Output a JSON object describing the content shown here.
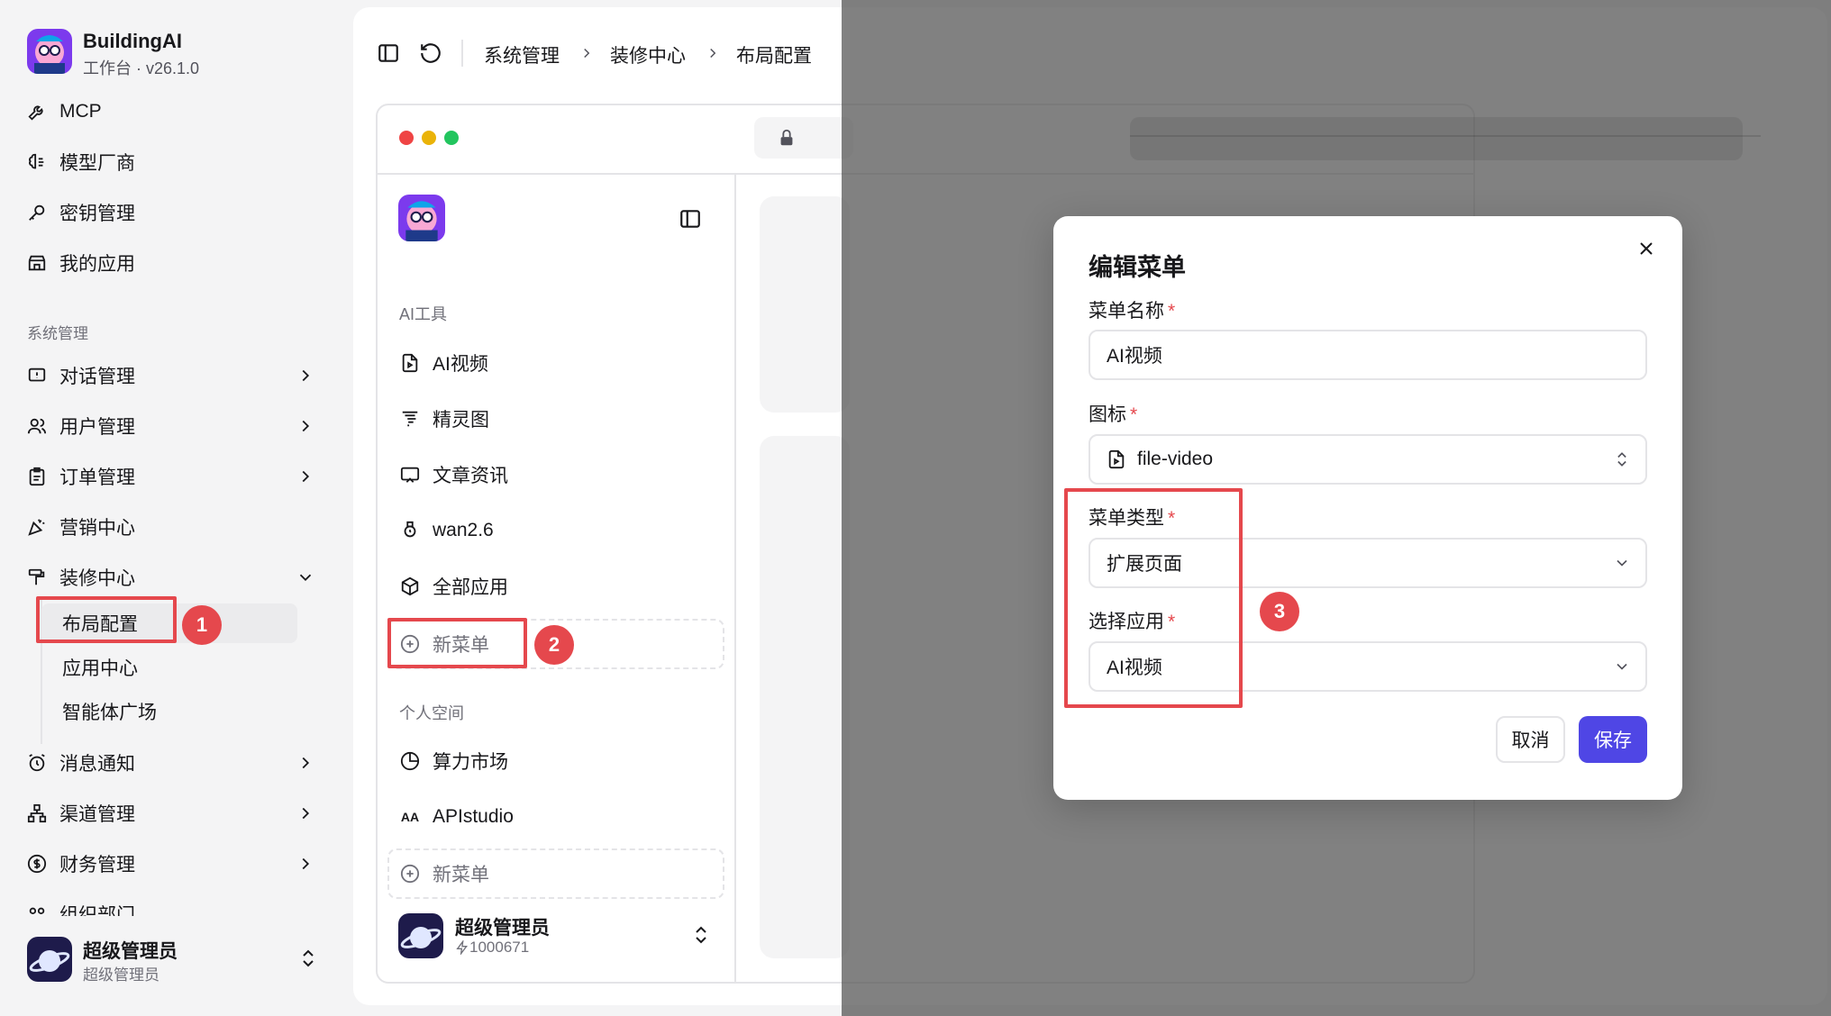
{
  "app": {
    "name": "BuildingAI",
    "subtitle": "工作台 · v26.1.0"
  },
  "sidebar": {
    "top_items": [
      "MCP",
      "模型厂商",
      "密钥管理",
      "我的应用"
    ],
    "section_label": "系统管理",
    "items": [
      "对话管理",
      "用户管理",
      "订单管理",
      "营销中心",
      "装修中心"
    ],
    "decor_sub": [
      "布局配置",
      "应用中心",
      "智能体广场"
    ],
    "items2": [
      "消息通知",
      "渠道管理",
      "财务管理",
      "组织部门"
    ],
    "user": {
      "name": "超级管理员",
      "role": "超级管理员"
    }
  },
  "annotations": [
    "1",
    "2",
    "3"
  ],
  "breadcrumb": [
    "系统管理",
    "装修中心",
    "布局配置"
  ],
  "preview": {
    "group1_label": "AI工具",
    "group1_items": [
      "AI视频",
      "精灵图",
      "文章资讯",
      "wan2.6",
      "全部应用"
    ],
    "new_menu": "新菜单",
    "group2_label": "个人空间",
    "group2_items": [
      "算力市场",
      "APIstudio"
    ],
    "user": {
      "name": "超级管理员",
      "points": "1000671"
    }
  },
  "dialog": {
    "title": "编辑菜单",
    "name_label": "菜单名称",
    "name_value": "AI视频",
    "icon_label": "图标",
    "icon_value": "file-video",
    "type_label": "菜单类型",
    "type_value": "扩展页面",
    "app_label": "选择应用",
    "app_value": "AI视频",
    "cancel": "取消",
    "save": "保存"
  },
  "colors": {
    "accent": "#4f46e5",
    "annotation": "#e5484d"
  }
}
